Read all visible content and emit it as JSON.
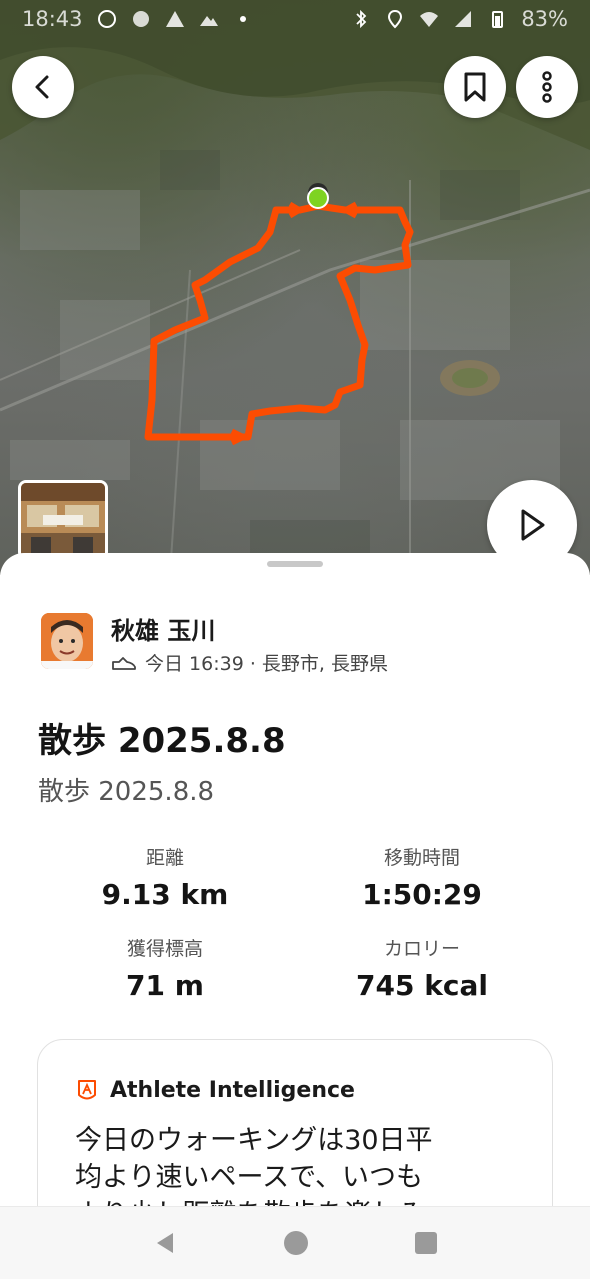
{
  "status_bar": {
    "time": "18:43",
    "battery": "83%"
  },
  "map": {
    "route_color": "#fc4c02",
    "start_marker_color": "#7ed321"
  },
  "buttons": {
    "back_icon": "chevron-left-icon",
    "bookmark_icon": "bookmark-icon",
    "more_icon": "more-vertical-icon",
    "play_icon": "play-icon"
  },
  "athlete": {
    "name": "秋雄 玉川",
    "activity_icon": "shoe-icon",
    "meta": "今日 16:39 · 長野市, 長野県"
  },
  "activity": {
    "title": "散歩 2025.8.8",
    "description": "散歩 2025.8.8"
  },
  "stats": {
    "distance_label": "距離",
    "distance_value": "9.13 km",
    "moving_time_label": "移動時間",
    "moving_time_value": "1:50:29",
    "elevation_label": "獲得標高",
    "elevation_value": "71 m",
    "calories_label": "カロリー",
    "calories_value": "745 kcal"
  },
  "athlete_intelligence": {
    "title": "Athlete Intelligence",
    "body_line1": "今日のウォーキングは30日平",
    "body_line2": "均より速いペースで、いつも",
    "body_line3": "より少し距離を散歩を楽しみ"
  },
  "colors": {
    "accent": "#fc4c02"
  }
}
